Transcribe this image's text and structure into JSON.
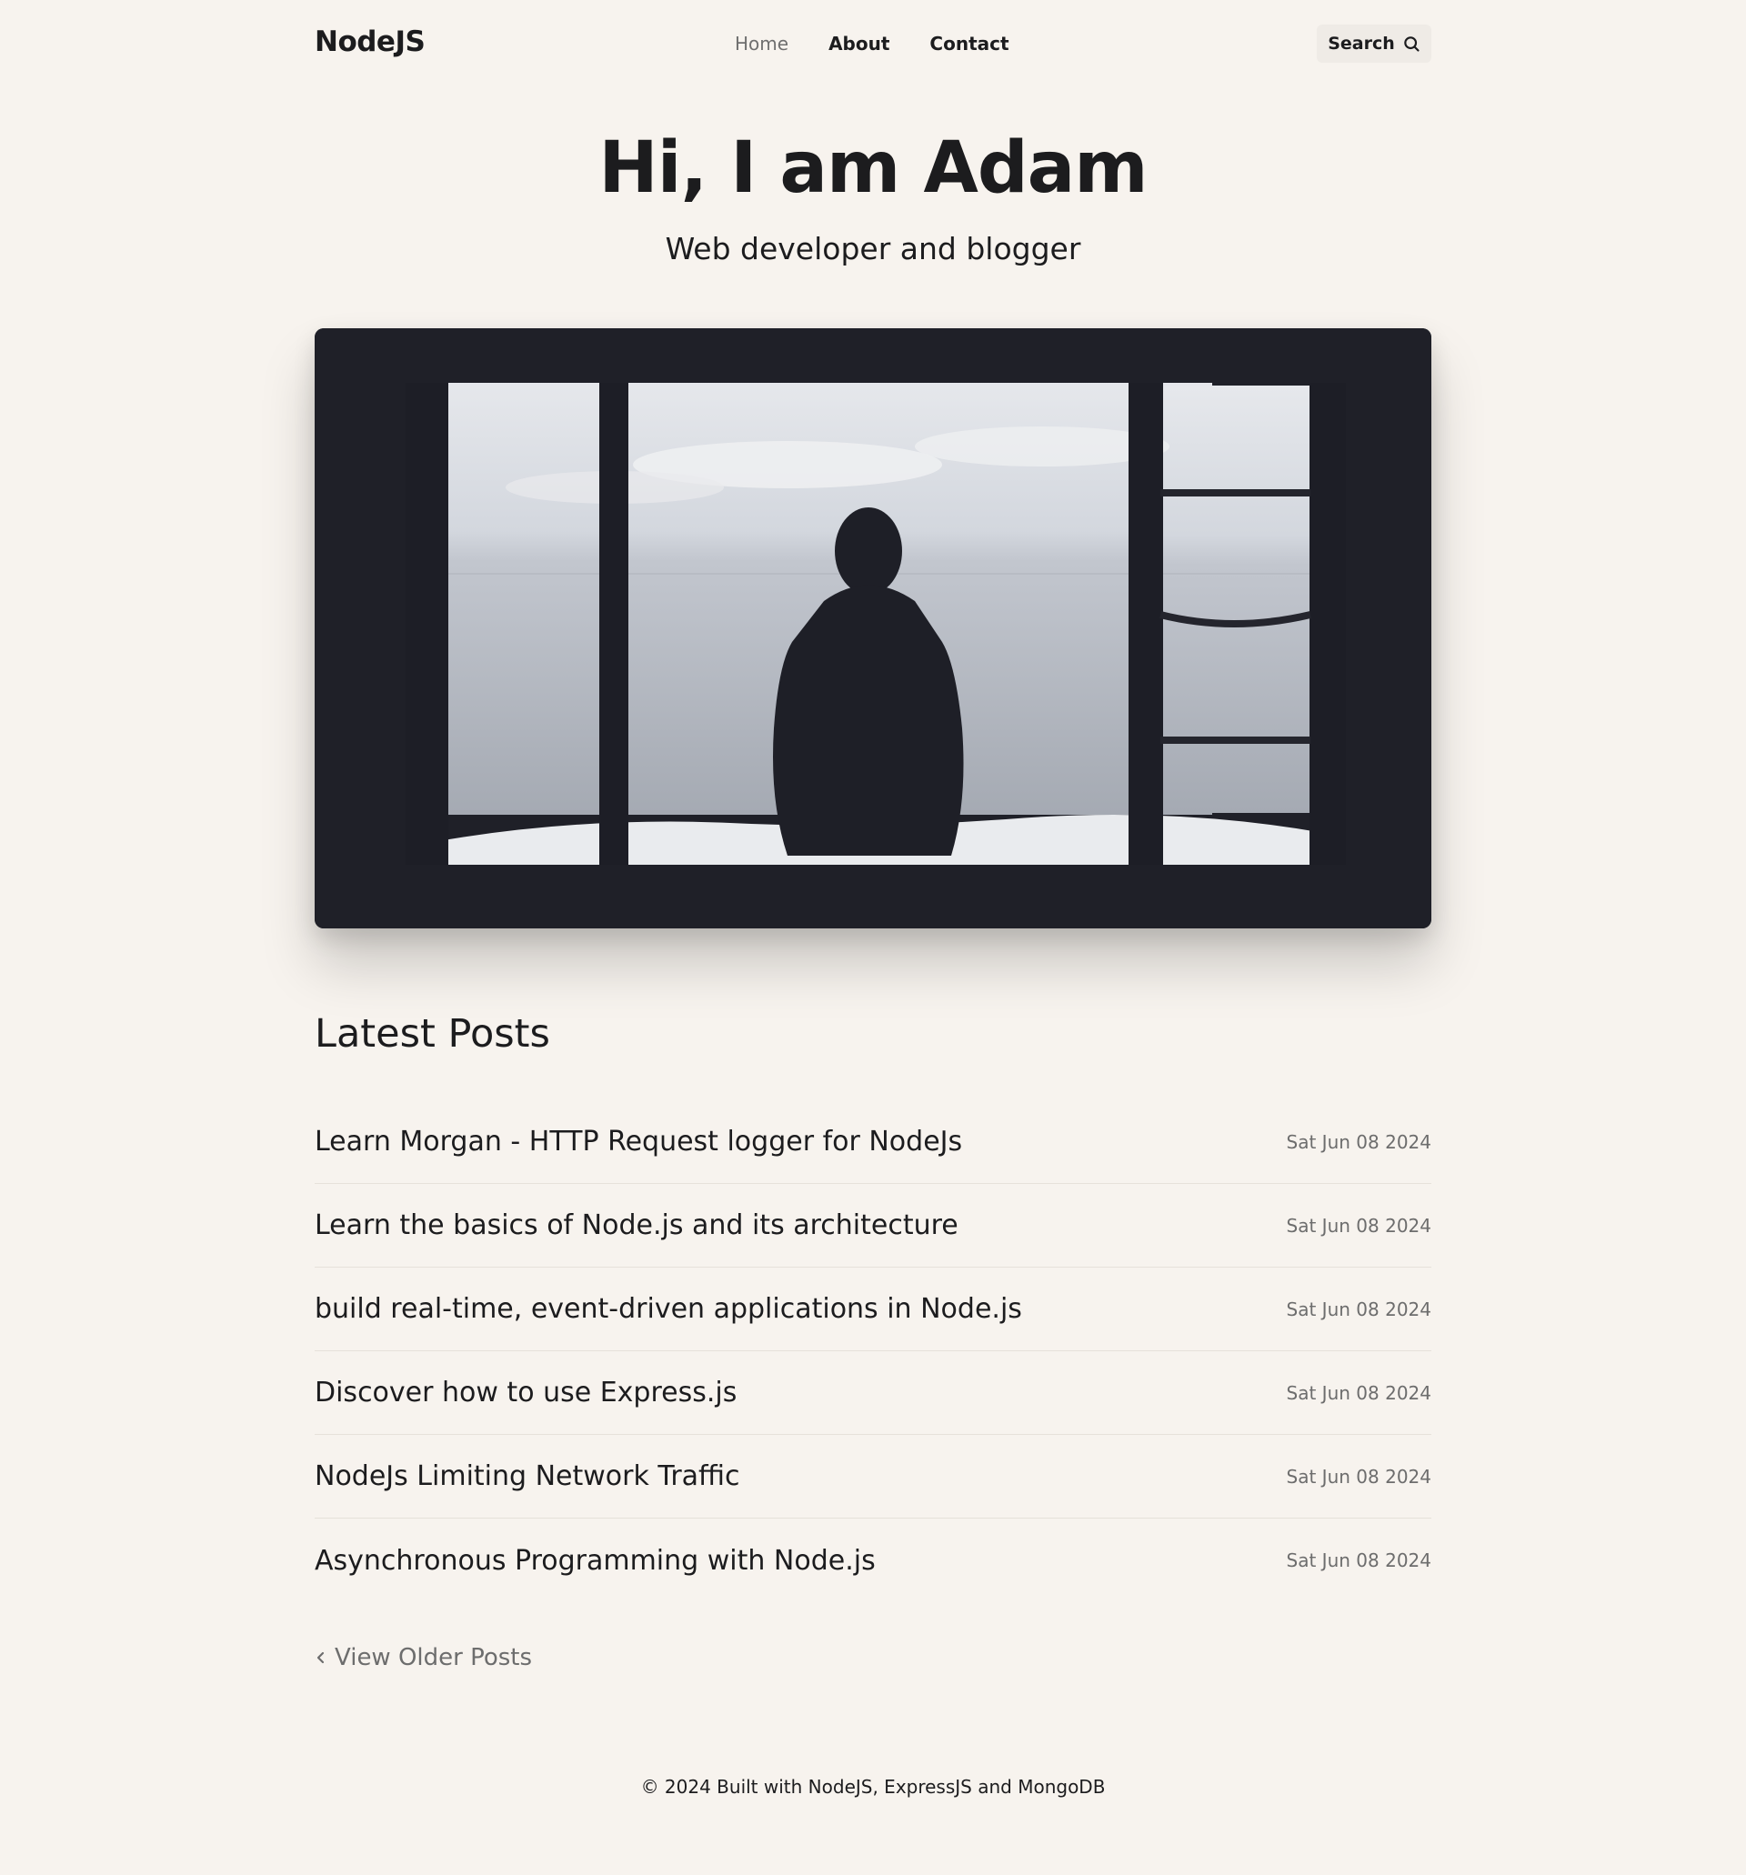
{
  "header": {
    "logo": "NodeJS",
    "nav": [
      {
        "label": "Home",
        "active": true
      },
      {
        "label": "About",
        "active": false
      },
      {
        "label": "Contact",
        "active": false
      }
    ],
    "search_label": "Search"
  },
  "hero": {
    "title": "Hi, I am Adam",
    "subtitle": "Web developer and blogger",
    "image_icon": "person-at-window-photo"
  },
  "posts": {
    "title": "Latest Posts",
    "items": [
      {
        "title": "Learn Morgan - HTTP Request logger for NodeJs",
        "date": "Sat Jun 08 2024"
      },
      {
        "title": "Learn the basics of Node.js and its architecture",
        "date": "Sat Jun 08 2024"
      },
      {
        "title": "build real-time, event-driven applications in Node.js",
        "date": "Sat Jun 08 2024"
      },
      {
        "title": "Discover how to use Express.js",
        "date": "Sat Jun 08 2024"
      },
      {
        "title": "NodeJs Limiting Network Traffic",
        "date": "Sat Jun 08 2024"
      },
      {
        "title": "Asynchronous Programming with Node.js",
        "date": "Sat Jun 08 2024"
      }
    ],
    "older_label": "View Older Posts"
  },
  "footer": {
    "text": "© 2024 Built with NodeJS, ExpressJS and MongoDB"
  },
  "colors": {
    "background": "#f7f3ee",
    "text": "#1c1c1e",
    "muted": "#6d6d6d",
    "search_bg": "#efebe6"
  }
}
